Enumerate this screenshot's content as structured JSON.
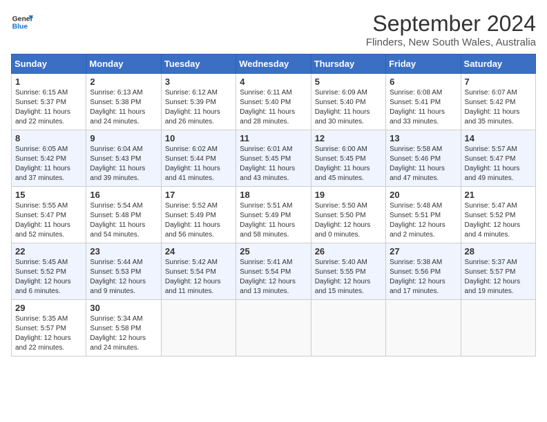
{
  "logo": {
    "line1": "General",
    "line2": "Blue"
  },
  "title": "September 2024",
  "location": "Flinders, New South Wales, Australia",
  "days_of_week": [
    "Sunday",
    "Monday",
    "Tuesday",
    "Wednesday",
    "Thursday",
    "Friday",
    "Saturday"
  ],
  "weeks": [
    [
      {
        "day": "1",
        "sunrise": "6:15 AM",
        "sunset": "5:37 PM",
        "daylight": "11 hours and 22 minutes."
      },
      {
        "day": "2",
        "sunrise": "6:13 AM",
        "sunset": "5:38 PM",
        "daylight": "11 hours and 24 minutes."
      },
      {
        "day": "3",
        "sunrise": "6:12 AM",
        "sunset": "5:39 PM",
        "daylight": "11 hours and 26 minutes."
      },
      {
        "day": "4",
        "sunrise": "6:11 AM",
        "sunset": "5:40 PM",
        "daylight": "11 hours and 28 minutes."
      },
      {
        "day": "5",
        "sunrise": "6:09 AM",
        "sunset": "5:40 PM",
        "daylight": "11 hours and 30 minutes."
      },
      {
        "day": "6",
        "sunrise": "6:08 AM",
        "sunset": "5:41 PM",
        "daylight": "11 hours and 33 minutes."
      },
      {
        "day": "7",
        "sunrise": "6:07 AM",
        "sunset": "5:42 PM",
        "daylight": "11 hours and 35 minutes."
      }
    ],
    [
      {
        "day": "8",
        "sunrise": "6:05 AM",
        "sunset": "5:42 PM",
        "daylight": "11 hours and 37 minutes."
      },
      {
        "day": "9",
        "sunrise": "6:04 AM",
        "sunset": "5:43 PM",
        "daylight": "11 hours and 39 minutes."
      },
      {
        "day": "10",
        "sunrise": "6:02 AM",
        "sunset": "5:44 PM",
        "daylight": "11 hours and 41 minutes."
      },
      {
        "day": "11",
        "sunrise": "6:01 AM",
        "sunset": "5:45 PM",
        "daylight": "11 hours and 43 minutes."
      },
      {
        "day": "12",
        "sunrise": "6:00 AM",
        "sunset": "5:45 PM",
        "daylight": "11 hours and 45 minutes."
      },
      {
        "day": "13",
        "sunrise": "5:58 AM",
        "sunset": "5:46 PM",
        "daylight": "11 hours and 47 minutes."
      },
      {
        "day": "14",
        "sunrise": "5:57 AM",
        "sunset": "5:47 PM",
        "daylight": "11 hours and 49 minutes."
      }
    ],
    [
      {
        "day": "15",
        "sunrise": "5:55 AM",
        "sunset": "5:47 PM",
        "daylight": "11 hours and 52 minutes."
      },
      {
        "day": "16",
        "sunrise": "5:54 AM",
        "sunset": "5:48 PM",
        "daylight": "11 hours and 54 minutes."
      },
      {
        "day": "17",
        "sunrise": "5:52 AM",
        "sunset": "5:49 PM",
        "daylight": "11 hours and 56 minutes."
      },
      {
        "day": "18",
        "sunrise": "5:51 AM",
        "sunset": "5:49 PM",
        "daylight": "11 hours and 58 minutes."
      },
      {
        "day": "19",
        "sunrise": "5:50 AM",
        "sunset": "5:50 PM",
        "daylight": "12 hours and 0 minutes."
      },
      {
        "day": "20",
        "sunrise": "5:48 AM",
        "sunset": "5:51 PM",
        "daylight": "12 hours and 2 minutes."
      },
      {
        "day": "21",
        "sunrise": "5:47 AM",
        "sunset": "5:52 PM",
        "daylight": "12 hours and 4 minutes."
      }
    ],
    [
      {
        "day": "22",
        "sunrise": "5:45 AM",
        "sunset": "5:52 PM",
        "daylight": "12 hours and 6 minutes."
      },
      {
        "day": "23",
        "sunrise": "5:44 AM",
        "sunset": "5:53 PM",
        "daylight": "12 hours and 9 minutes."
      },
      {
        "day": "24",
        "sunrise": "5:42 AM",
        "sunset": "5:54 PM",
        "daylight": "12 hours and 11 minutes."
      },
      {
        "day": "25",
        "sunrise": "5:41 AM",
        "sunset": "5:54 PM",
        "daylight": "12 hours and 13 minutes."
      },
      {
        "day": "26",
        "sunrise": "5:40 AM",
        "sunset": "5:55 PM",
        "daylight": "12 hours and 15 minutes."
      },
      {
        "day": "27",
        "sunrise": "5:38 AM",
        "sunset": "5:56 PM",
        "daylight": "12 hours and 17 minutes."
      },
      {
        "day": "28",
        "sunrise": "5:37 AM",
        "sunset": "5:57 PM",
        "daylight": "12 hours and 19 minutes."
      }
    ],
    [
      {
        "day": "29",
        "sunrise": "5:35 AM",
        "sunset": "5:57 PM",
        "daylight": "12 hours and 22 minutes."
      },
      {
        "day": "30",
        "sunrise": "5:34 AM",
        "sunset": "5:58 PM",
        "daylight": "12 hours and 24 minutes."
      },
      null,
      null,
      null,
      null,
      null
    ]
  ]
}
